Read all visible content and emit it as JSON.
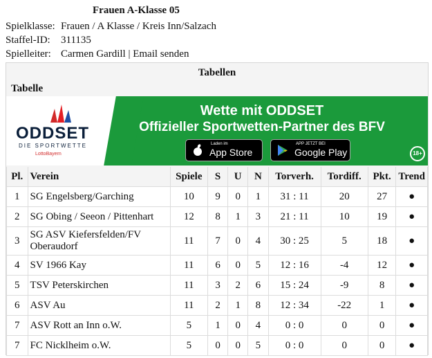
{
  "league": {
    "title": "Frauen A-Klasse 05",
    "meta": [
      {
        "label": "Spielklasse:",
        "value": "Frauen / A Klasse / Kreis Inn/Salzach"
      },
      {
        "label": "Staffel-ID:",
        "value": "311135"
      },
      {
        "label": "Spielleiter:",
        "value": "Carmen Gardill | Email senden"
      }
    ]
  },
  "section": {
    "title": "Tabellen",
    "subtitle": "Tabelle"
  },
  "banner": {
    "brand": "ODDSET",
    "brand_sub": "DIE SPORTWETTE",
    "brand_lotto": "LottoBayern",
    "headline1": "Wette mit ODDSET",
    "headline2": "Offizieller Sportwetten-Partner des BFV",
    "appstore_small": "Laden im",
    "appstore_big": "App Store",
    "googleplay_small": "APP JETZT BEI",
    "googleplay_big": "Google Play",
    "age": "18+",
    "colors": {
      "green": "#1b9a3b",
      "navy": "#0b1f3a"
    }
  },
  "table": {
    "headers": [
      "Pl.",
      "Verein",
      "Spiele",
      "S",
      "U",
      "N",
      "Torverh.",
      "Tordiff.",
      "Pkt.",
      "Trend"
    ],
    "rows": [
      {
        "pl": "1",
        "team": "SG Engelsberg/Garching",
        "games": "10",
        "w": "9",
        "d": "0",
        "l": "1",
        "goals": "31 : 11",
        "diff": "20",
        "pts": "27",
        "trend": "●"
      },
      {
        "pl": "2",
        "team": "SG Obing / Seeon / Pittenhart",
        "games": "12",
        "w": "8",
        "d": "1",
        "l": "3",
        "goals": "21 : 11",
        "diff": "10",
        "pts": "19",
        "trend": "●"
      },
      {
        "pl": "3",
        "team": "SG ASV Kiefersfelden/FV Oberaudorf",
        "games": "11",
        "w": "7",
        "d": "0",
        "l": "4",
        "goals": "30 : 25",
        "diff": "5",
        "pts": "18",
        "trend": "●"
      },
      {
        "pl": "4",
        "team": "SV 1966 Kay",
        "games": "11",
        "w": "6",
        "d": "0",
        "l": "5",
        "goals": "12 : 16",
        "diff": "-4",
        "pts": "12",
        "trend": "●"
      },
      {
        "pl": "5",
        "team": "TSV Peterskirchen",
        "games": "11",
        "w": "3",
        "d": "2",
        "l": "6",
        "goals": "15 : 24",
        "diff": "-9",
        "pts": "8",
        "trend": "●"
      },
      {
        "pl": "6",
        "team": "ASV Au",
        "games": "11",
        "w": "2",
        "d": "1",
        "l": "8",
        "goals": "12 : 34",
        "diff": "-22",
        "pts": "1",
        "trend": "●"
      },
      {
        "pl": "7",
        "team": "ASV Rott an Inn o.W.",
        "games": "5",
        "w": "1",
        "d": "0",
        "l": "4",
        "goals": "0 : 0",
        "diff": "0",
        "pts": "0",
        "trend": "●"
      },
      {
        "pl": "7",
        "team": "FC Nicklheim o.W.",
        "games": "5",
        "w": "0",
        "d": "0",
        "l": "5",
        "goals": "0 : 0",
        "diff": "0",
        "pts": "0",
        "trend": "●"
      }
    ]
  }
}
